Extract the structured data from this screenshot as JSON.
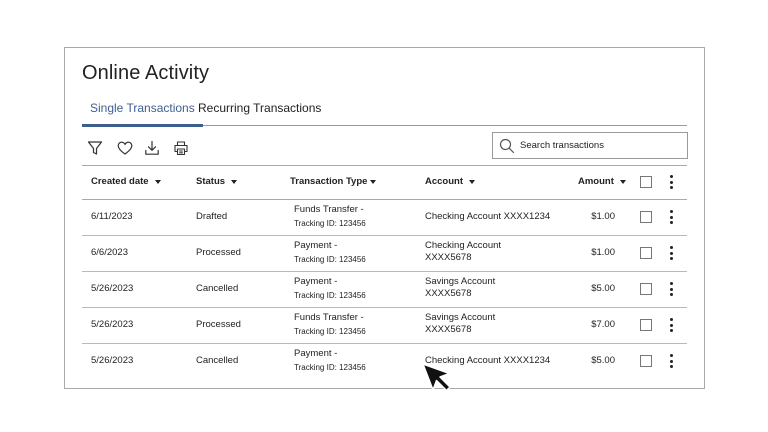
{
  "page_title": "Online Activity",
  "tabs": [
    {
      "label": "Single Transactions",
      "active": true
    },
    {
      "label": "Recurring Transactions",
      "active": false
    }
  ],
  "toolbar": {
    "icons": [
      "filter-icon",
      "heart-icon",
      "download-icon",
      "print-icon"
    ],
    "search_placeholder": "Search transactions"
  },
  "table": {
    "columns": [
      "Created date",
      "Status",
      "Transaction Type",
      "Account",
      "Amount"
    ],
    "rows": [
      {
        "date": "6/11/2023",
        "status": "Drafted",
        "type": "Funds Transfer -",
        "tracking": "Tracking ID: 123456",
        "account": "Checking Account XXXX1234",
        "account_line2": "",
        "amount": "$1.00"
      },
      {
        "date": "6/6/2023",
        "status": "Processed",
        "type": "Payment -",
        "tracking": "Tracking ID: 123456",
        "account": "Checking Account",
        "account_line2": "XXXX5678",
        "amount": "$1.00"
      },
      {
        "date": "5/26/2023",
        "status": "Cancelled",
        "type": "Payment -",
        "tracking": "Tracking ID: 123456",
        "account": "Savings Account",
        "account_line2": "XXXX5678",
        "amount": "$5.00"
      },
      {
        "date": "5/26/2023",
        "status": "Processed",
        "type": "Funds Transfer -",
        "tracking": "Tracking ID: 123456",
        "account": "Savings Account",
        "account_line2": "XXXX5678",
        "amount": "$7.00"
      },
      {
        "date": "5/26/2023",
        "status": "Cancelled",
        "type": "Payment -",
        "tracking": "Tracking ID: 123456",
        "account": "Checking Account XXXX1234",
        "account_line2": "",
        "amount": "$5.00"
      }
    ]
  },
  "colors": {
    "accent": "#3d5f8f",
    "border": "#a9a9a9",
    "text": "#222222"
  }
}
